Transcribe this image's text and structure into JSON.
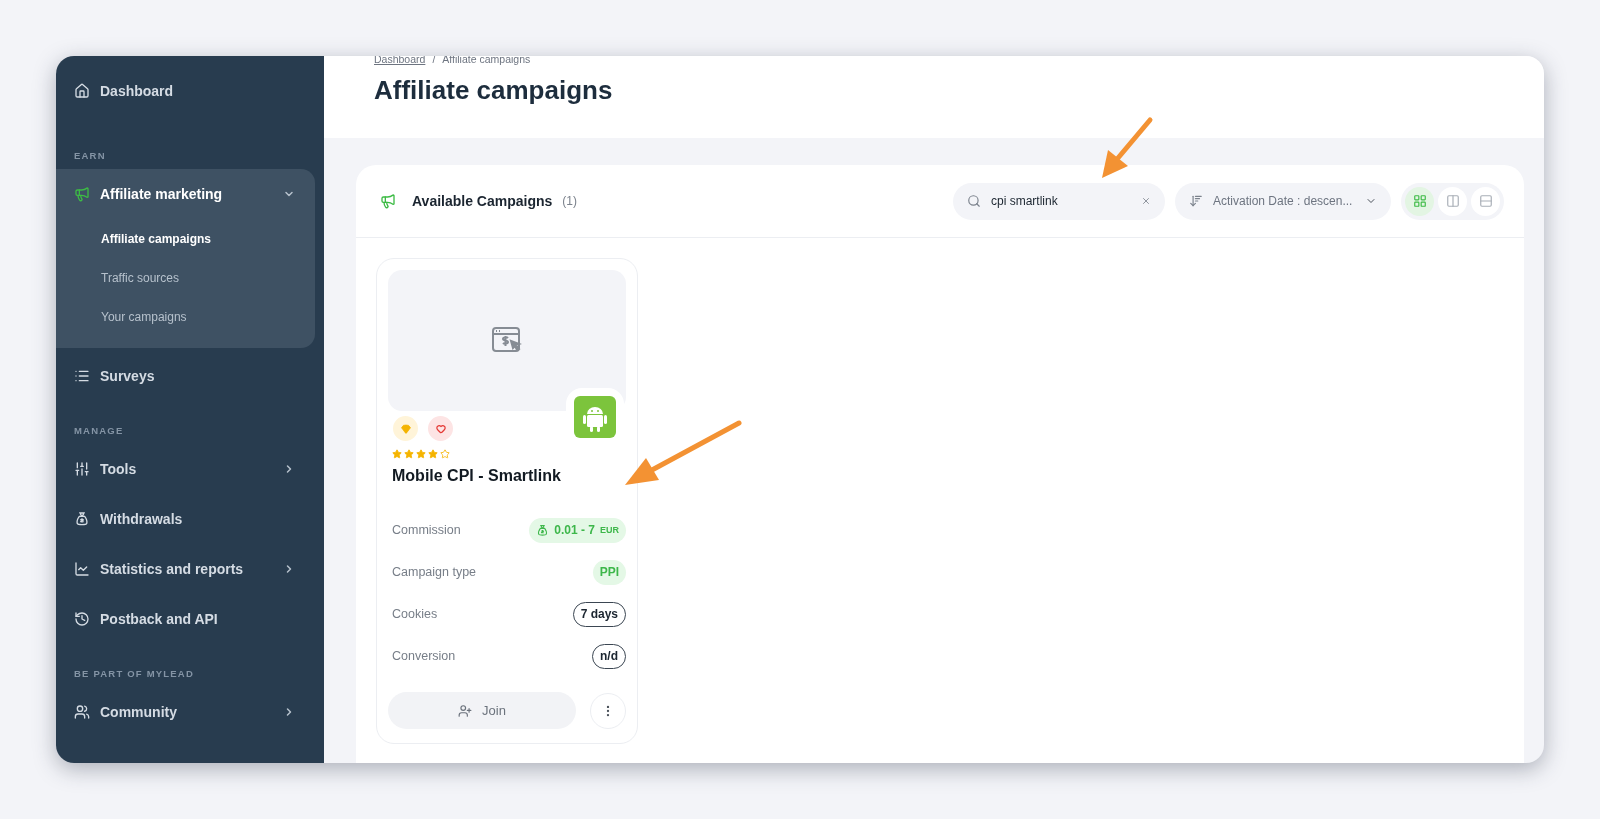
{
  "sidebar": {
    "items": [
      {
        "kind": "link",
        "label": "Dashboard"
      },
      {
        "kind": "section",
        "label": "EARN"
      },
      {
        "kind": "group",
        "label": "Affiliate marketing",
        "expanded": true,
        "children": [
          {
            "label": "Affiliate campaigns",
            "selected": true
          },
          {
            "label": "Traffic sources",
            "selected": false
          },
          {
            "label": "Your campaigns",
            "selected": false
          }
        ]
      },
      {
        "kind": "link",
        "label": "Surveys"
      },
      {
        "kind": "section",
        "label": "MANAGE"
      },
      {
        "kind": "group",
        "label": "Tools",
        "expanded": false
      },
      {
        "kind": "link",
        "label": "Withdrawals"
      },
      {
        "kind": "group",
        "label": "Statistics and reports",
        "expanded": false
      },
      {
        "kind": "link",
        "label": "Postback and API"
      },
      {
        "kind": "section",
        "label": "BE PART OF MYLEAD"
      },
      {
        "kind": "group",
        "label": "Community",
        "expanded": false
      }
    ]
  },
  "breadcrumb": {
    "items": [
      "Dashboard",
      "Affiliate campaigns"
    ],
    "separator": "/"
  },
  "title": "Affiliate campaigns",
  "panel": {
    "title": "Available Campaigns",
    "count": "(1)",
    "search": {
      "value": "cpi smartlink"
    },
    "sort": {
      "value": "Activation Date : descen..."
    },
    "views": [
      {
        "selected": true
      },
      {
        "selected": false
      },
      {
        "selected": false
      }
    ]
  },
  "campaigns": [
    {
      "stars": 4,
      "title": "Mobile CPI - Smartlink",
      "rows": [
        {
          "kind": "money",
          "label": "Commission",
          "value": "0.01 - 7",
          "unit": "EUR"
        },
        {
          "kind": "type",
          "label": "Campaign type",
          "value": "PPI"
        },
        {
          "kind": "outline",
          "label": "Cookies",
          "value": "7 days"
        },
        {
          "kind": "outline",
          "label": "Conversion",
          "value": "n/d"
        }
      ],
      "join": "Join"
    }
  ]
}
